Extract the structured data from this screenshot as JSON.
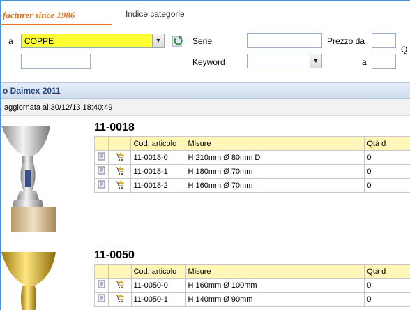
{
  "header": {
    "brand_text": "facturer since 1986",
    "category_index": "Indice categorie"
  },
  "filters": {
    "category_prefix": "a",
    "category_value": "COPPE",
    "serie_label": "Serie",
    "keyword_label": "Keyword",
    "price_from_label": "Prezzo da",
    "price_to_label": "a",
    "qty_label": "Q"
  },
  "section": {
    "title": "o Daimex 2011",
    "updated": "aggiornata al 30/12/13 18:40:49"
  },
  "columns": {
    "code": "Cod. articolo",
    "measures": "Misure",
    "qty": "Qtà d"
  },
  "products": [
    {
      "code": "11-0018",
      "rows": [
        {
          "code": "11-0018-0",
          "measures": "H 210mm Ø 80mm D",
          "qty": "0"
        },
        {
          "code": "11-0018-1",
          "measures": "H 180mm Ø 70mm",
          "qty": "0"
        },
        {
          "code": "11-0018-2",
          "measures": "H 160mm Ø 70mm",
          "qty": "0"
        }
      ]
    },
    {
      "code": "11-0050",
      "rows": [
        {
          "code": "11-0050-0",
          "measures": "H 160mm Ø 100mm",
          "qty": "0"
        },
        {
          "code": "11-0050-1",
          "measures": "H 140mm Ø 90mm",
          "qty": "0"
        }
      ]
    }
  ],
  "icons": {
    "detail": "document-icon",
    "cart": "cart-add-icon",
    "refresh": "refresh-icon",
    "dropdown": "chevron-down-icon"
  },
  "colors": {
    "brand": "#e8731a",
    "highlight": "#ffff33",
    "header_row": "#fff6b8",
    "frame": "#4a90d9"
  }
}
